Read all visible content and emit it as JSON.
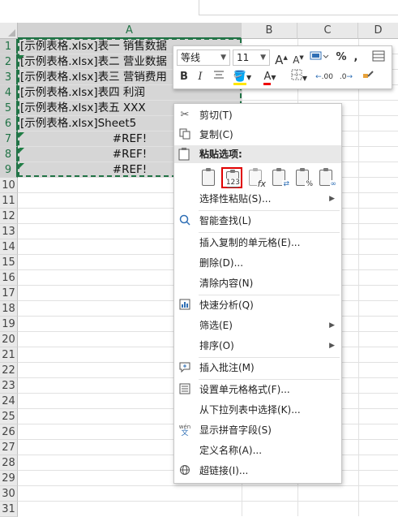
{
  "columns": [
    "A",
    "B",
    "C",
    "D"
  ],
  "rows": [
    "1",
    "2",
    "3",
    "4",
    "5",
    "6",
    "7",
    "8",
    "9",
    "10",
    "11",
    "12",
    "13",
    "14",
    "15",
    "16",
    "17",
    "18",
    "19",
    "20",
    "21",
    "22",
    "23",
    "24",
    "25",
    "26",
    "27",
    "28",
    "29",
    "30",
    "31"
  ],
  "cells": [
    "[示例表格.xlsx]表一 销售数据",
    "[示例表格.xlsx]表二 营业数据",
    "[示例表格.xlsx]表三 营销费用",
    "[示例表格.xlsx]表四 利润",
    "[示例表格.xlsx]表五 XXX",
    "[示例表格.xlsx]Sheet5",
    "#REF!",
    "#REF!",
    "#REF!"
  ],
  "mini_toolbar": {
    "font_name": "等线",
    "font_size": "11",
    "grow_font": "A",
    "shrink_font": "A",
    "percent": "%",
    "comma": ",",
    "bold": "B",
    "italic": "I",
    "font_color": "A",
    "dec_increase": ".00",
    "dec_decrease": ".0"
  },
  "context_menu": {
    "cut": "剪切(T)",
    "copy": "复制(C)",
    "paste_options": "粘贴选项:",
    "paste_values_tag": "123",
    "paste_formula_tag": "fx",
    "paste_percent_tag": "%",
    "paste_special": "选择性粘贴(S)...",
    "smart_lookup": "智能查找(L)",
    "insert_copied": "插入复制的单元格(E)...",
    "delete": "删除(D)...",
    "clear": "清除内容(N)",
    "quick_analysis": "快速分析(Q)",
    "filter": "筛选(E)",
    "sort": "排序(O)",
    "insert_comment": "插入批注(M)",
    "format_cells": "设置单元格格式(F)...",
    "pick_list": "从下拉列表中选择(K)...",
    "phonetic": "显示拼音字段(S)",
    "define_name": "定义名称(A)...",
    "hyperlink": "超链接(I)...",
    "phonetic_icon_top": "wén",
    "phonetic_icon_bottom": "文"
  },
  "colors": {
    "accent": "#217346",
    "highlight_box": "#e00000"
  }
}
